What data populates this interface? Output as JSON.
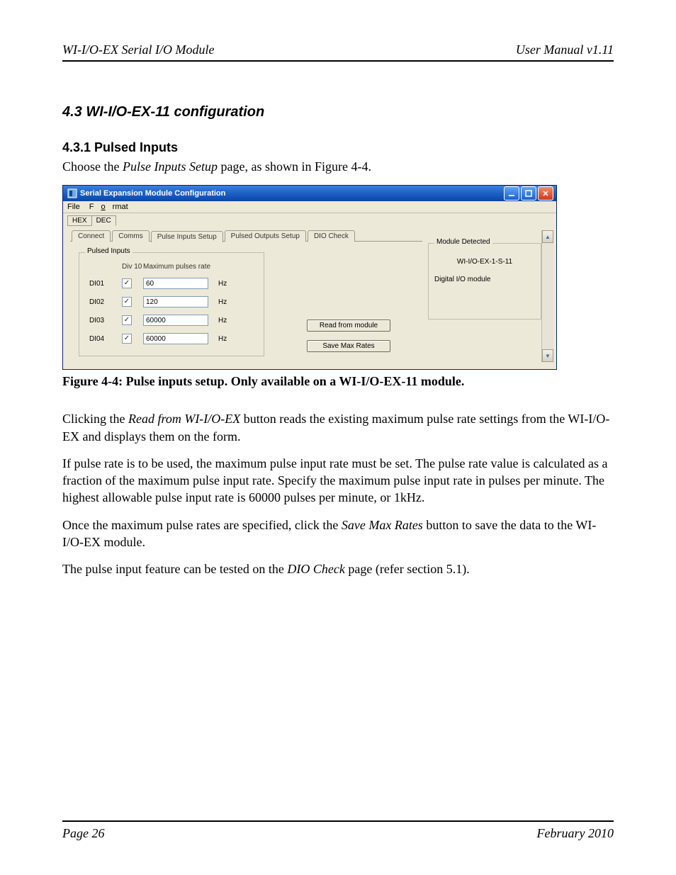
{
  "header": {
    "left": "WI-I/O-EX Serial I/O Module",
    "right": "User Manual v1.11"
  },
  "section": {
    "num_title": "4.3   WI-I/O-EX-11 configuration"
  },
  "subsection": {
    "num_title": "4.3.1  Pulsed Inputs"
  },
  "intro_pre": "Choose the ",
  "intro_ital": "Pulse Inputs Setup",
  "intro_post": " page, as shown in Figure 4-4.",
  "caption": "Figure 4-4: Pulse inputs setup. Only available on a WI-I/O-EX-11 module.",
  "p2_pre": "Clicking the ",
  "p2_ital": "Read from WI-I/O-EX",
  "p2_post": " button reads the existing maximum pulse rate settings from the WI-I/O-EX and displays them on the form.",
  "p3": "If pulse rate is to be used, the maximum pulse input rate must be set. The pulse rate value is calculated as a fraction of the maximum pulse input rate. Specify the maximum pulse input rate in pulses per minute. The highest allowable pulse input rate is 60000 pulses per minute, or 1kHz.",
  "p4_pre": "Once the maximum pulse rates are specified, click the ",
  "p4_ital": "Save Max Rates",
  "p4_post": " button to save the data to the WI-I/O-EX module.",
  "p5_pre": "The pulse input feature can be tested on the ",
  "p5_ital": "DIO Check",
  "p5_post": " page (refer section 5.1).",
  "footer": {
    "left": "Page  26",
    "right": "February 2010"
  },
  "app": {
    "title": "Serial Expansion Module Configuration",
    "menu": {
      "file": "File",
      "format": "Format"
    },
    "toolbar": {
      "hex": "HEX",
      "dec": "DEC"
    },
    "tabs": {
      "connect": "Connect",
      "comms": "Comms",
      "pulse_in": "Pulse Inputs Setup",
      "pulse_out": "Pulsed Outputs Setup",
      "dio": "DIO Check"
    },
    "group_title": "Pulsed Inputs",
    "col_div": "Div 10",
    "col_max": "Maximum pulses rate",
    "unit": "Hz",
    "rows": [
      {
        "label": "DI01",
        "checked": true,
        "value": "60"
      },
      {
        "label": "DI02",
        "checked": true,
        "value": "120"
      },
      {
        "label": "DI03",
        "checked": true,
        "value": "60000"
      },
      {
        "label": "DI04",
        "checked": true,
        "value": "60000"
      }
    ],
    "btn_read": "Read from module",
    "btn_save": "Save Max Rates",
    "module_box_title": "Module Detected",
    "module_line1": "WI-I/O-EX-1-S-11",
    "module_line2": "Digital I/O module"
  }
}
